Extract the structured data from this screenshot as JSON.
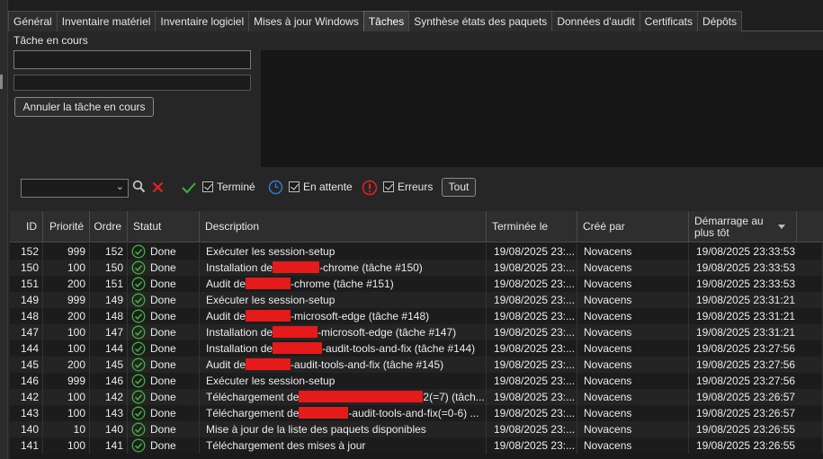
{
  "tabs": [
    {
      "label": "Général",
      "active": false
    },
    {
      "label": "Inventaire matériel",
      "active": false
    },
    {
      "label": "Inventaire logiciel",
      "active": false
    },
    {
      "label": "Mises à jour Windows",
      "active": false
    },
    {
      "label": "Tâches",
      "active": true
    },
    {
      "label": "Synthèse états des paquets",
      "active": false
    },
    {
      "label": "Données d'audit",
      "active": false
    },
    {
      "label": "Certificats",
      "active": false
    },
    {
      "label": "Dépôts",
      "active": false
    }
  ],
  "current_task": {
    "label": "Tâche en cours",
    "input_value": "",
    "cancel_label": "Annuler la tâche en cours"
  },
  "filter": {
    "combo_value": "",
    "termine_label": "Terminé",
    "attente_label": "En attente",
    "erreurs_label": "Erreurs",
    "tout_label": "Tout",
    "termine_checked": true,
    "attente_checked": true,
    "erreurs_checked": true
  },
  "colors": {
    "done_green": "#3fae3f",
    "clock_blue": "#2f7fd6",
    "error_red": "#e52222",
    "redaction": "#e51a1a"
  },
  "table": {
    "columns": [
      "ID",
      "Priorité",
      "Ordre",
      "Statut",
      "Description",
      "Terminée le",
      "Créé par",
      "Démarrage au plus tôt"
    ],
    "sorted_column": "Démarrage au plus tôt",
    "sort_direction": "descending",
    "rows": [
      {
        "id": "152",
        "priority": "999",
        "order": "152",
        "status": "Done",
        "desc_pre": "Exécuter les session-setup",
        "desc_post": "",
        "finished": "19/08/2025 23:...",
        "created_by": "Novacens",
        "start": "19/08/2025 23:33:53"
      },
      {
        "id": "150",
        "priority": "100",
        "order": "150",
        "status": "Done",
        "desc_pre": "Installation de",
        "desc_post": "-chrome (tâche #150)",
        "finished": "19/08/2025 23:...",
        "created_by": "Novacens",
        "start": "19/08/2025 23:33:53"
      },
      {
        "id": "151",
        "priority": "200",
        "order": "151",
        "status": "Done",
        "desc_pre": "Audit de",
        "desc_post": "-chrome (tâche #151)",
        "finished": "19/08/2025 23:...",
        "created_by": "Novacens",
        "start": "19/08/2025 23:33:53"
      },
      {
        "id": "149",
        "priority": "999",
        "order": "149",
        "status": "Done",
        "desc_pre": "Exécuter les session-setup",
        "desc_post": "",
        "finished": "19/08/2025 23:...",
        "created_by": "Novacens",
        "start": "19/08/2025 23:31:21"
      },
      {
        "id": "148",
        "priority": "200",
        "order": "148",
        "status": "Done",
        "desc_pre": "Audit de",
        "desc_post": "-microsoft-edge (tâche #148)",
        "finished": "19/08/2025 23:...",
        "created_by": "Novacens",
        "start": "19/08/2025 23:31:21"
      },
      {
        "id": "147",
        "priority": "100",
        "order": "147",
        "status": "Done",
        "desc_pre": "Installation de",
        "desc_post": "-microsoft-edge (tâche #147)",
        "finished": "19/08/2025 23:...",
        "created_by": "Novacens",
        "start": "19/08/2025 23:31:21"
      },
      {
        "id": "144",
        "priority": "100",
        "order": "144",
        "status": "Done",
        "desc_pre": "Installation de",
        "desc_post": "-audit-tools-and-fix (tâche #144)",
        "finished": "19/08/2025 23:...",
        "created_by": "Novacens",
        "start": "19/08/2025 23:27:56"
      },
      {
        "id": "145",
        "priority": "200",
        "order": "145",
        "status": "Done",
        "desc_pre": "Audit de",
        "desc_post": "-audit-tools-and-fix (tâche #145)",
        "finished": "19/08/2025 23:...",
        "created_by": "Novacens",
        "start": "19/08/2025 23:27:56"
      },
      {
        "id": "146",
        "priority": "999",
        "order": "146",
        "status": "Done",
        "desc_pre": "Exécuter les session-setup",
        "desc_post": "",
        "finished": "19/08/2025 23:...",
        "created_by": "Novacens",
        "start": "19/08/2025 23:27:56"
      },
      {
        "id": "142",
        "priority": "100",
        "order": "142",
        "status": "Done",
        "desc_pre": "Téléchargement de",
        "desc_post": "2(=7) (tâch...",
        "finished": "19/08/2025 23:...",
        "created_by": "Novacens",
        "start": "19/08/2025 23:26:57"
      },
      {
        "id": "143",
        "priority": "100",
        "order": "143",
        "status": "Done",
        "desc_pre": "Téléchargement de",
        "desc_post": "-audit-tools-and-fix(=0-6) ...",
        "finished": "19/08/2025 23:...",
        "created_by": "Novacens",
        "start": "19/08/2025 23:26:57"
      },
      {
        "id": "140",
        "priority": "10",
        "order": "140",
        "status": "Done",
        "desc_pre": "Mise à jour de la liste des paquets disponibles",
        "desc_post": "",
        "finished": "19/08/2025 23:...",
        "created_by": "Novacens",
        "start": "19/08/2025 23:26:55"
      },
      {
        "id": "141",
        "priority": "100",
        "order": "141",
        "status": "Done",
        "desc_pre": "Téléchargement des mises à jour",
        "desc_post": "",
        "finished": "19/08/2025 23:...",
        "created_by": "Novacens",
        "start": "19/08/2025 23:26:55"
      }
    ]
  }
}
